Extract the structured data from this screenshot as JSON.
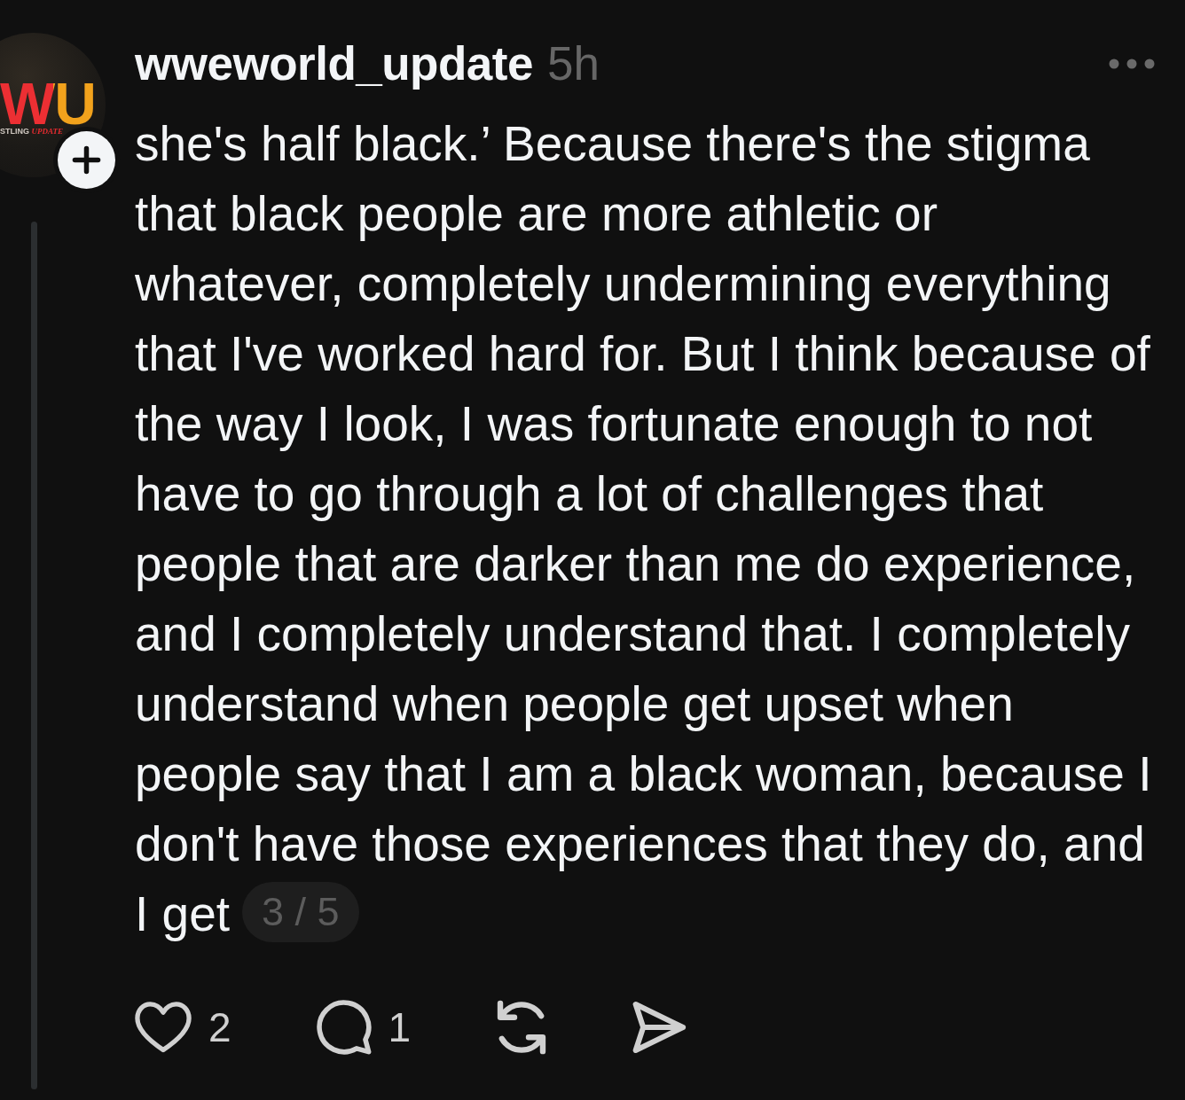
{
  "avatar": {
    "logo_text": "WU",
    "tagline": "STLING *UPDATE*"
  },
  "header": {
    "username": "wweworld_update",
    "time": "5h"
  },
  "post": {
    "text": "she's half black.’ Because there's the stigma\nthat black people are more athletic or\nwhatever, completely undermining everything\nthat I've worked hard for. But I think because of\nthe way I look, I was fortunate enough to not\nhave to go through a lot of challenges that\npeople that are darker than me do experience,\nand I completely understand that. I completely\nunderstand when people get upset when\npeople say that I am a black woman, because I\ndon't have those experiences that they do, and\nI get",
    "page_indicator": "3 / 5"
  },
  "actions": [
    {
      "kind": "like",
      "count": "2"
    },
    {
      "kind": "reply",
      "count": "1"
    },
    {
      "kind": "repost"
    },
    {
      "kind": "share"
    }
  ]
}
